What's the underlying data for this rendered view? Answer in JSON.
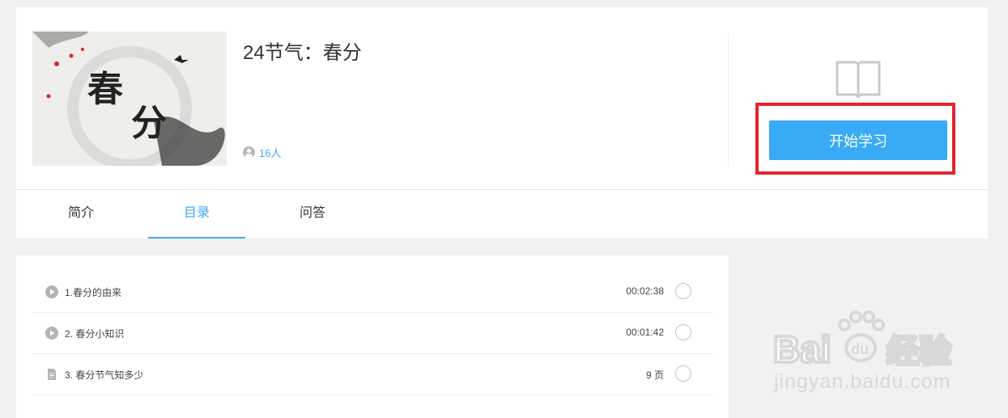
{
  "course": {
    "title": "24节气：春分",
    "learners": "16人",
    "cover": {
      "title": "春",
      "subtitle": "分"
    },
    "start_button": "开始学习",
    "accent": "#3fa9f5",
    "highlight_color": "#e3242b"
  },
  "tabs": [
    {
      "label": "简介",
      "active": false
    },
    {
      "label": "目录",
      "active": true
    },
    {
      "label": "问答",
      "active": false
    }
  ],
  "catalog": [
    {
      "icon": "play-icon",
      "title": "1.春分的由来",
      "meta": "00:02:38"
    },
    {
      "icon": "play-icon",
      "title": "2. 春分小知识",
      "meta": "00:01:42"
    },
    {
      "icon": "document-icon",
      "title": "3. 春分节气知多少",
      "meta": "9 页"
    }
  ],
  "watermark": {
    "text": "jingyan.baidu.com"
  }
}
